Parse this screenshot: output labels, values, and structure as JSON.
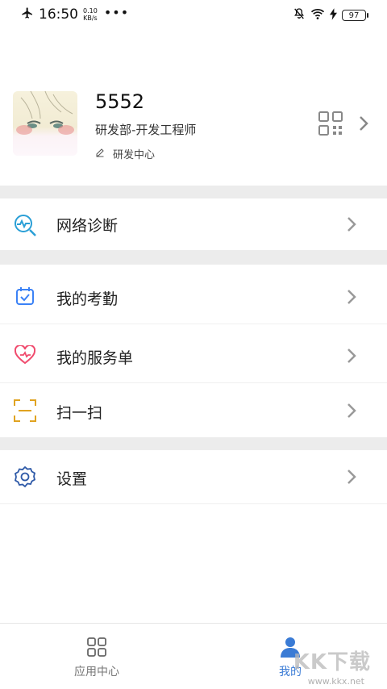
{
  "status_bar": {
    "time": "16:50",
    "speed_value": "0.10",
    "speed_unit": "KB/s",
    "battery": "97"
  },
  "profile": {
    "name": "5552",
    "department": "研发部-开发工程师",
    "center": "研发中心"
  },
  "menu": {
    "network": "网络诊断",
    "attendance": "我的考勤",
    "service": "我的服务单",
    "scan": "扫一扫",
    "settings": "设置"
  },
  "tabbar": {
    "apps": "应用中心",
    "mine": "我的"
  },
  "watermark": {
    "brand": "KK下载",
    "url": "www.kkx.net"
  },
  "colors": {
    "accent": "#3a7bd5",
    "section_gap": "#ececec",
    "attendance_icon": "#3b82f6",
    "service_icon": "#f04a6d",
    "scan_icon": "#e0a321",
    "network_icon": "#2a9fd6",
    "settings_icon": "#2f5aa8"
  }
}
